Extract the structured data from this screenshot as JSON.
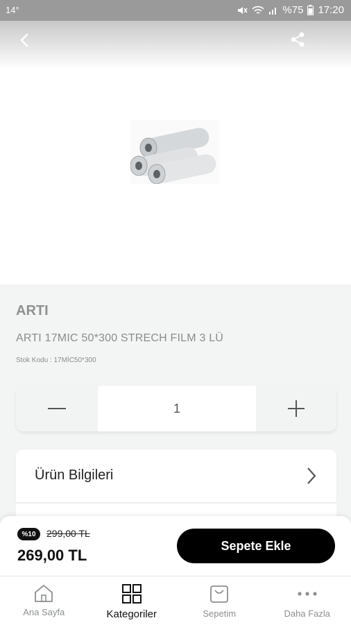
{
  "status_bar": {
    "temperature": "14°",
    "battery": "%75",
    "time": "17:20"
  },
  "product": {
    "brand": "ARTI",
    "title": "ARTI 17MIC 50*300 STRECH FILM 3 LÜ",
    "stock_code": "Stok Kodu : 17MİC50*300"
  },
  "quantity": {
    "value": "1"
  },
  "sections": {
    "product_info_label": "Ürün Bilgileri"
  },
  "price": {
    "discount_badge": "%10",
    "old_price": "299,00 TL",
    "current_price": "269,00 TL",
    "add_to_cart_label": "Sepete Ekle"
  },
  "tabs": [
    {
      "label": "Ana Sayfa",
      "icon": "home-icon"
    },
    {
      "label": "Kategoriler",
      "icon": "grid-icon"
    },
    {
      "label": "Sepetim",
      "icon": "bag-icon"
    },
    {
      "label": "Daha Fazla",
      "icon": "more-icon"
    }
  ]
}
